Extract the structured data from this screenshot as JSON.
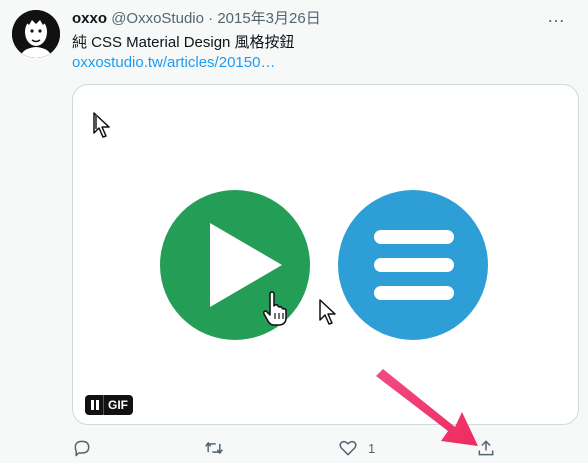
{
  "tweet": {
    "author_name": "oxxo",
    "handle": "@OxxoStudio",
    "separator": "·",
    "date": "2015年3月26日",
    "more": "…",
    "text": "純 CSS Material Design 風格按鈕",
    "link": "oxxostudio.tw/articles/20150…"
  },
  "media": {
    "gif_label": "GIF"
  },
  "actions": {
    "reply_count": "",
    "retweet_count": "",
    "like_count": "1",
    "share_count": ""
  },
  "colors": {
    "link": "#1d9bf0",
    "play_green": "#249d57",
    "menu_blue": "#2e9fd6",
    "annotation_arrow": "#f0306c"
  }
}
